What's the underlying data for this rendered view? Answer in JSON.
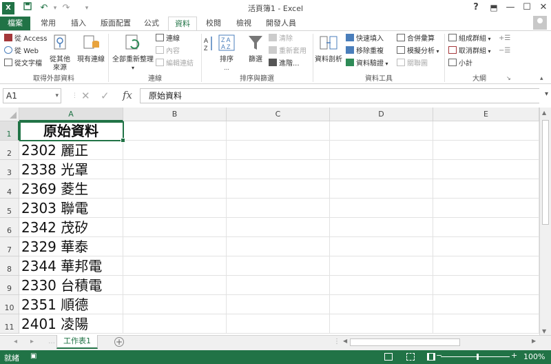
{
  "window": {
    "title": "活頁簿1 - Excel",
    "help": "?",
    "app_logo": "X",
    "buttons": [
      "?",
      "⬒",
      "—",
      "☐",
      "✕"
    ]
  },
  "qat": {
    "save": "💾",
    "undo": "↶",
    "redo": "↷",
    "customize": "▾"
  },
  "tabs": [
    "檔案",
    "常用",
    "插入",
    "版面配置",
    "公式",
    "資料",
    "校閱",
    "檢視",
    "開發人員"
  ],
  "active_tab": "資料",
  "ribbon": {
    "external": {
      "access": "從 Access",
      "web": "從 Web",
      "text": "從文字檔",
      "other": "從其他\n來源",
      "existing": "現有連線",
      "label": "取得外部資料"
    },
    "connections": {
      "refresh_all": "全部重新整理",
      "conn": "連線",
      "props": "內容",
      "edit_links": "編輯連結",
      "label": "連線"
    },
    "sort_filter": {
      "sort": "排序",
      "filter": "篩選",
      "clear": "清除",
      "reapply": "重新套用",
      "advanced": "進階...",
      "label": "排序與篩選"
    },
    "data_tools": {
      "text_to_columns": "資料剖析",
      "flash_fill": "快速填入",
      "remove_dup": "移除重複",
      "validation": "資料驗證",
      "consolidate": "合併彙算",
      "what_if": "模擬分析",
      "relationships": "關聯圖",
      "label": "資料工具"
    },
    "outline": {
      "group": "組成群組",
      "ungroup": "取消群組",
      "subtotal": "小計",
      "label": "大綱"
    }
  },
  "formula_bar": {
    "name_box": "A1",
    "cancel": "✕",
    "enter": "✓",
    "fx": "fx",
    "content": "原始資料"
  },
  "columns": [
    "A",
    "B",
    "C",
    "D",
    "E"
  ],
  "rows": [
    "1",
    "2",
    "3",
    "4",
    "5",
    "6",
    "7",
    "8",
    "9",
    "10",
    "11"
  ],
  "cells_A": [
    "原始資料",
    "2302 麗正",
    "2338 光罩",
    "2369 菱生",
    "2303 聯電",
    "2342 茂矽",
    "2329 華泰",
    "2344 華邦電",
    "2330 台積電",
    "2351 順德",
    "2401 凌陽"
  ],
  "sheets": [
    "工作表1"
  ],
  "add_sheet": "+",
  "status": {
    "ready": "就緒",
    "zoom": "100%",
    "minus": "−",
    "plus": "+"
  }
}
